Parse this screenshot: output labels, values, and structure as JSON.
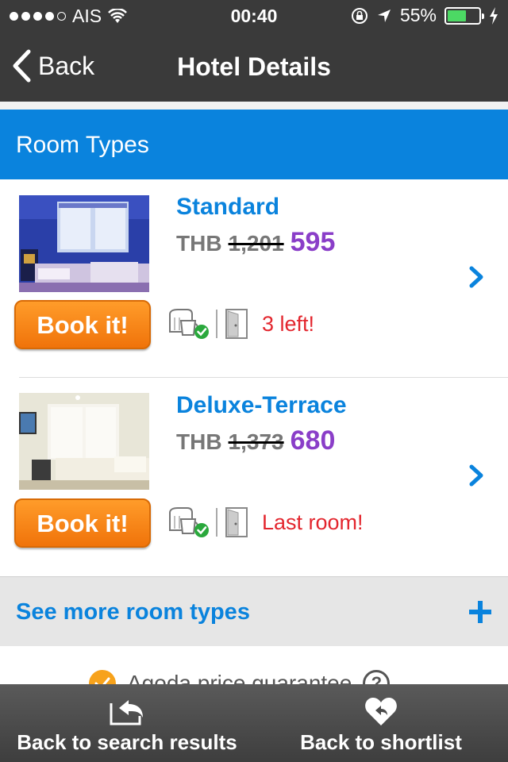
{
  "status": {
    "carrier": "AIS",
    "time": "00:40",
    "battery": "55%"
  },
  "nav": {
    "back_label": "Back",
    "title": "Hotel Details"
  },
  "section": {
    "title": "Room Types"
  },
  "rooms": [
    {
      "name": "Standard",
      "currency": "THB",
      "old_price": "1,201",
      "new_price": "595",
      "book_label": "Book it!",
      "availability": "3 left!"
    },
    {
      "name": "Deluxe-Terrace",
      "currency": "THB",
      "old_price": "1,373",
      "new_price": "680",
      "book_label": "Book it!",
      "availability": "Last room!"
    }
  ],
  "see_more": {
    "label": "See more room types"
  },
  "guarantee": {
    "label": "Agoda price guarantee"
  },
  "bottom_bar": {
    "search_label": "Back to search results",
    "shortlist_label": "Back to shortlist"
  },
  "colors": {
    "accent_blue": "#0a83dd",
    "price_purple": "#8a3ec8",
    "book_orange": "#f7891a",
    "alert_red": "#e3262e",
    "bar_dark": "#3a3a3a"
  }
}
